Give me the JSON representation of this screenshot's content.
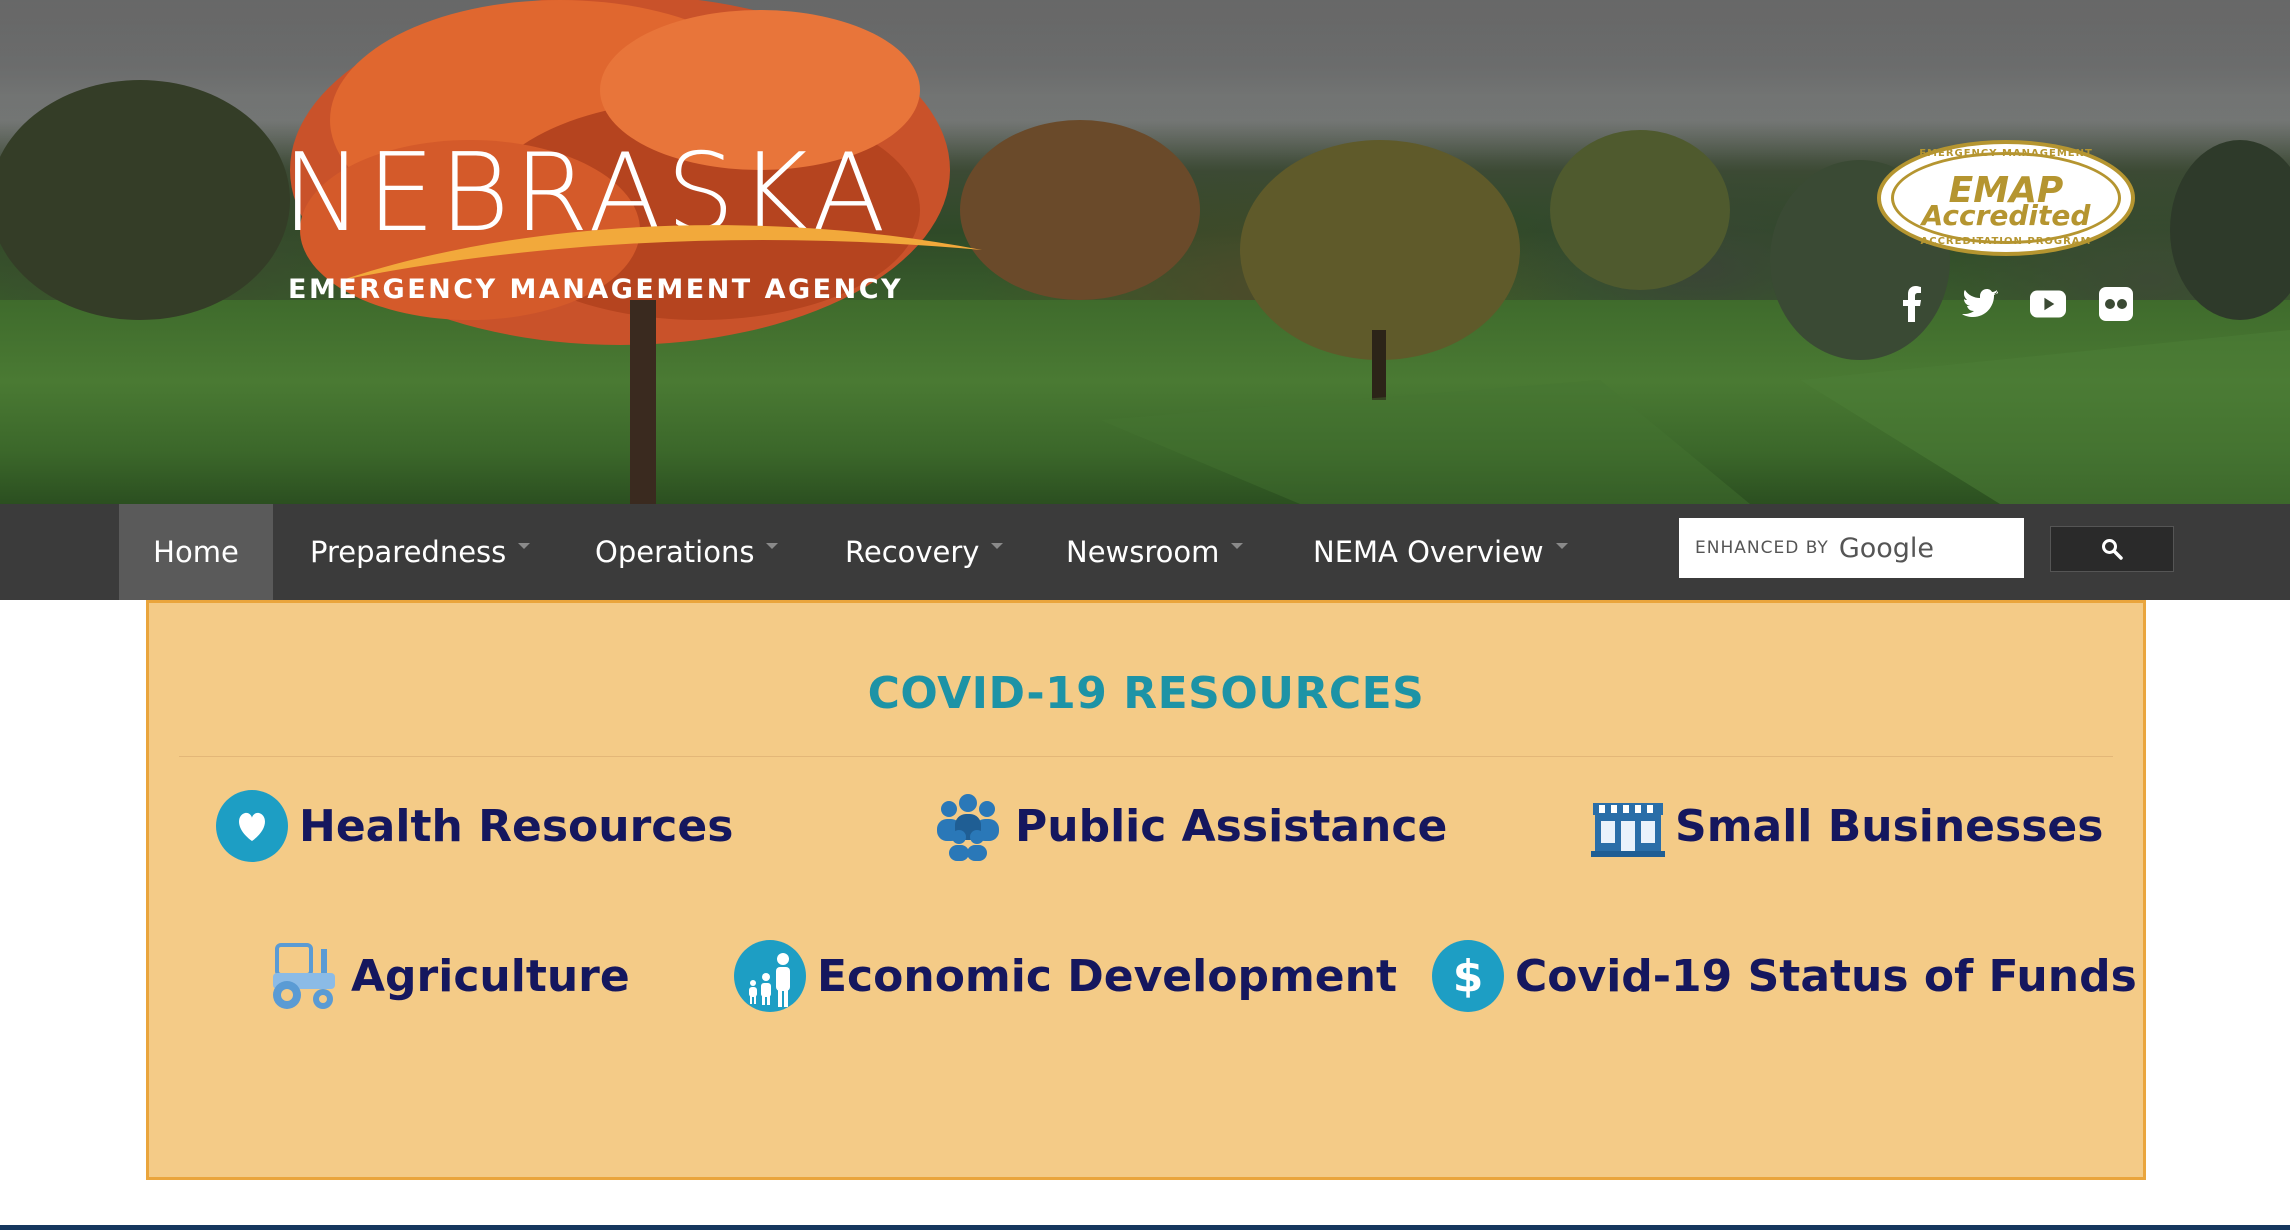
{
  "header": {
    "logo_word": "NEBRASKA",
    "logo_subtitle": "EMERGENCY MANAGEMENT AGENCY",
    "badge": {
      "line1": "EMAP",
      "line2": "Accredited",
      "arc_top": "EMERGENCY MANAGEMENT",
      "arc_bottom": "ACCREDITATION PROGRAM"
    },
    "social_icons": [
      "facebook-icon",
      "twitter-icon",
      "youtube-icon",
      "flickr-icon"
    ]
  },
  "nav": {
    "items": [
      {
        "label": "Home",
        "active": true,
        "dropdown": false
      },
      {
        "label": "Preparedness",
        "active": false,
        "dropdown": true
      },
      {
        "label": "Operations",
        "active": false,
        "dropdown": true
      },
      {
        "label": "Recovery",
        "active": false,
        "dropdown": true
      },
      {
        "label": "Newsroom",
        "active": false,
        "dropdown": true
      },
      {
        "label": "NEMA Overview",
        "active": false,
        "dropdown": true
      }
    ],
    "search": {
      "enhanced_by": "ENHANCED BY",
      "provider": "Google",
      "button_icon": "search-icon"
    }
  },
  "covid": {
    "title": "COVID-19 RESOURCES",
    "resources": [
      {
        "label": "Health Resources",
        "icon": "heart-icon"
      },
      {
        "label": "Public Assistance",
        "icon": "people-group-icon"
      },
      {
        "label": "Small Businesses",
        "icon": "storefront-icon"
      },
      {
        "label": "Agriculture",
        "icon": "tractor-icon"
      },
      {
        "label": "Economic Development",
        "icon": "family-icon"
      },
      {
        "label": "Covid-19 Status of Funds",
        "icon": "dollar-icon"
      }
    ]
  },
  "colors": {
    "nav_bg": "#3b3b3b",
    "nav_active_bg": "#5a5a5a",
    "covid_bg": "#f4cb87",
    "covid_border": "#eaa53c",
    "covid_title": "#1d93a6",
    "resource_text": "#15175e",
    "badge_gold": "#b59530"
  }
}
